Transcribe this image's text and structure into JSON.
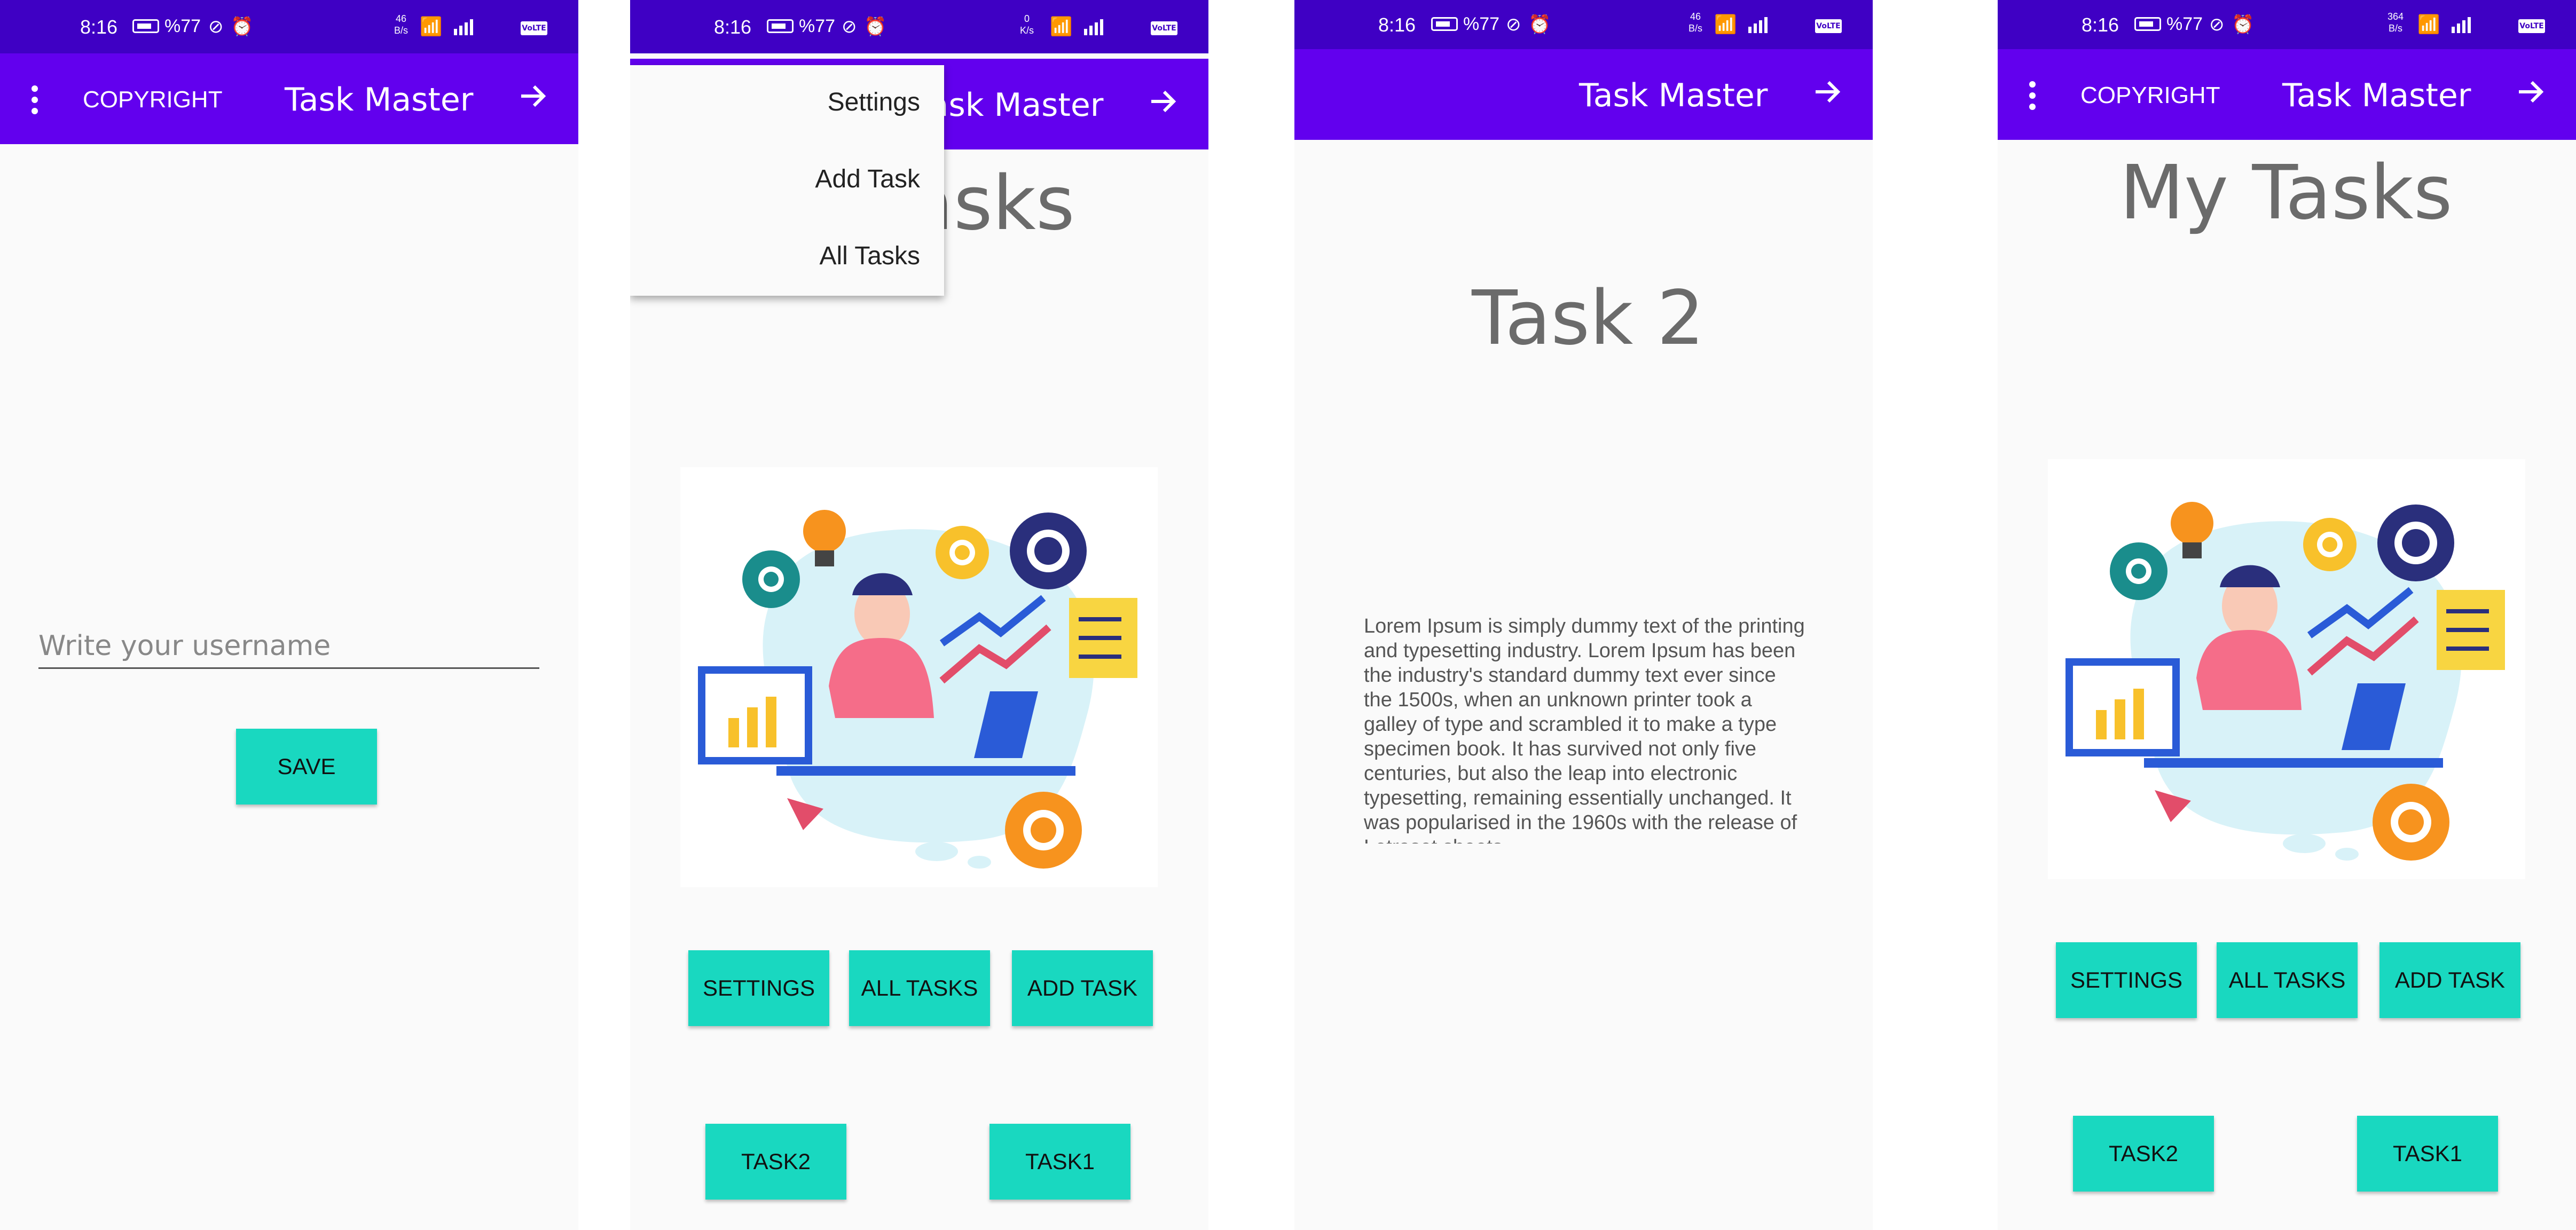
{
  "status_bar": {
    "time": "8:16",
    "battery": "%77",
    "network_rates": [
      "46\nB/s",
      "0\nK/s",
      "46\nB/s",
      "364\nB/s"
    ],
    "volte": "VoLTE",
    "color": "#3f00c4"
  },
  "app_bar": {
    "title": "Task Master",
    "copyright": "COPYRIGHT",
    "color": "#6200ee",
    "icons": [
      "more-vert-icon",
      "arrow-forward-icon"
    ]
  },
  "screen1": {
    "username_placeholder": "Write your username",
    "username_value": "",
    "save_button": "SAVE"
  },
  "screen2": {
    "overflow_menu": [
      "Settings",
      "Add Task",
      "All Tasks"
    ],
    "title_visible": "asks",
    "buttons": [
      "SETTINGS",
      "ALL TASKS",
      "ADD TASK"
    ],
    "task_buttons": [
      "TASK2",
      "TASK1"
    ]
  },
  "screen3": {
    "task_title": "Task 2",
    "description": "Lorem Ipsum is simply dummy text of the printing and typesetting industry. Lorem Ipsum has been the industry's standard dummy text ever since the 1500s, when an unknown printer took a galley of type and scrambled it to make a type specimen book. It has survived not only five centuries, but also the leap into electronic typesetting, remaining essentially unchanged. It was popularised in the 1960s with the release of Letraset sheets"
  },
  "screen4": {
    "title": "My Tasks",
    "buttons": [
      "SETTINGS",
      "ALL TASKS",
      "ADD TASK"
    ],
    "task_buttons": [
      "TASK2",
      "TASK1"
    ]
  },
  "colors": {
    "button_bg": "#19d8c0",
    "title_gray": "#6b6b6b"
  }
}
